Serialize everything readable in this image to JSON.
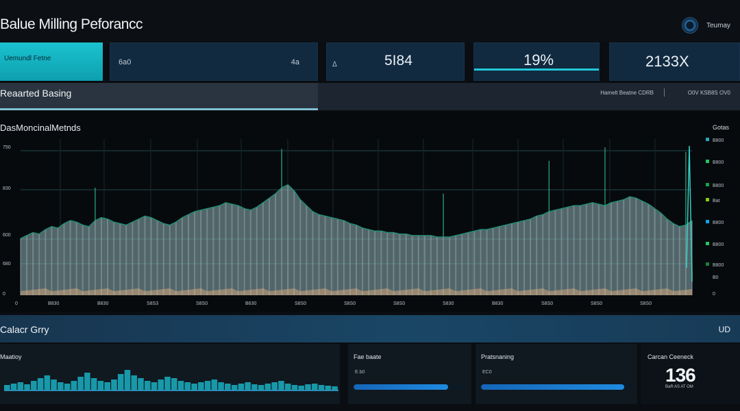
{
  "header": {
    "title": "Balue Milling Peforancc",
    "user_name": "Teumay"
  },
  "kpis": {
    "k1_label": "Uemundl Fetne",
    "k2_left": "6a0",
    "k2_right": "4a",
    "k3_prefix": "ᐃ",
    "k3_value": "5I84",
    "k4_value": "19%",
    "k5_value": "2133X"
  },
  "section": {
    "title": "Reaarted Basing",
    "meta1": "Hamelt Beatne CDRB",
    "meta2": "O0V KSB8S OV0"
  },
  "chart": {
    "title": "DasMoncinalMetnds",
    "legend_title": "Gotas"
  },
  "chart_data": {
    "type": "area",
    "title": "DasMoncinalMetnds",
    "y_ticks": [
      "750",
      "830",
      "600",
      "680",
      "0"
    ],
    "x_ticks": [
      "0",
      "B830",
      "B830",
      "S8S3",
      "S8S0",
      "B630",
      "S8S0",
      "S8S0",
      "S8S0",
      "S830",
      "B830",
      "S8S0",
      "S8S0",
      "S8S0"
    ],
    "y_right_ticks": [
      "B800",
      "B800",
      "B800",
      "Bat",
      "B800",
      "B800",
      "B800",
      "B0",
      "0"
    ],
    "legend": [
      {
        "name": "B800",
        "color": "#2aa7b8"
      },
      {
        "name": "B800",
        "color": "#22c55e"
      },
      {
        "name": "B800",
        "color": "#16a34a"
      },
      {
        "name": "Bat",
        "color": "#84cc16"
      },
      {
        "name": "B800",
        "color": "#0ea5e9"
      },
      {
        "name": "B800",
        "color": "#22c55e"
      },
      {
        "name": "B800",
        "color": "#15803d"
      }
    ],
    "main_series": [
      38,
      40,
      42,
      41,
      44,
      46,
      45,
      48,
      50,
      49,
      47,
      46,
      50,
      52,
      51,
      49,
      48,
      47,
      49,
      51,
      53,
      52,
      50,
      48,
      47,
      49,
      52,
      54,
      56,
      57,
      58,
      59,
      60,
      62,
      61,
      60,
      58,
      57,
      59,
      62,
      65,
      68,
      72,
      74,
      70,
      64,
      60,
      56,
      54,
      53,
      52,
      51,
      50,
      48,
      47,
      45,
      44,
      43,
      43,
      42,
      42,
      41,
      41,
      40,
      40,
      40,
      40,
      39,
      39,
      39,
      40,
      41,
      42,
      43,
      44,
      44,
      45,
      46,
      47,
      48,
      49,
      50,
      51,
      53,
      54,
      56,
      57,
      58,
      59,
      60,
      60,
      61,
      62,
      61,
      60,
      62,
      63,
      64,
      66,
      65,
      63,
      61,
      58,
      55,
      51,
      48,
      46,
      47,
      50
    ],
    "spikes": [
      {
        "i": 42,
        "v": 98
      },
      {
        "i": 94,
        "v": 99
      },
      {
        "i": 85,
        "v": 90
      },
      {
        "i": 107,
        "v": 96
      },
      {
        "i": 12,
        "v": 72
      },
      {
        "i": 68,
        "v": 68
      }
    ]
  },
  "band": {
    "title": "Calacr Grry",
    "right": "UD"
  },
  "bottom": {
    "b1_title": "Maatioy",
    "b2_title": "Fae baate",
    "b2_sub": "E.b0",
    "b2_progress": 0.86,
    "b3_title": "Pratsnaning",
    "b3_sub": "EC0",
    "b3_progress": 0.95,
    "b4_title": "Carcan Ceeneck",
    "b4_value": "136",
    "b4_sub": "BaR AS AT OM",
    "mini_series": [
      8,
      10,
      12,
      9,
      14,
      18,
      22,
      16,
      12,
      10,
      14,
      20,
      26,
      18,
      14,
      12,
      16,
      24,
      30,
      22,
      18,
      14,
      12,
      16,
      20,
      18,
      14,
      12,
      10,
      12,
      14,
      16,
      12,
      10,
      8,
      10,
      12,
      9,
      8,
      10,
      12,
      14,
      10,
      8,
      7,
      9,
      10,
      8,
      7,
      6
    ]
  },
  "colors": {
    "accent": "#1ac3cf",
    "chart_fill": "#8fb0b6",
    "chart_line": "#1f8f75",
    "progress": "#1f8be0"
  }
}
